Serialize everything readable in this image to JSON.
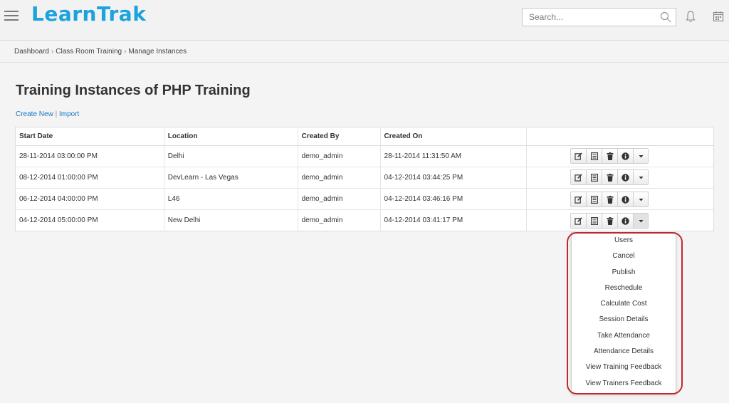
{
  "app": {
    "logo": "LearnTrak"
  },
  "search": {
    "placeholder": "Search..."
  },
  "breadcrumb": [
    "Dashboard",
    "Class Room Training",
    "Manage Instances"
  ],
  "page": {
    "title": "Training Instances of PHP Training"
  },
  "actions": {
    "create_new": "Create New",
    "separator": "|",
    "import": "Import"
  },
  "table": {
    "headers": [
      "Start Date",
      "Location",
      "Created By",
      "Created On",
      ""
    ],
    "rows": [
      {
        "start_date": "28-11-2014 03:00:00 PM",
        "location": "Delhi",
        "created_by": "demo_admin",
        "created_on": "28-11-2014 11:31:50 AM"
      },
      {
        "start_date": "08-12-2014 01:00:00 PM",
        "location": "DevLearn - Las Vegas",
        "created_by": "demo_admin",
        "created_on": "04-12-2014 03:44:25 PM"
      },
      {
        "start_date": "06-12-2014 04:00:00 PM",
        "location": "L46",
        "created_by": "demo_admin",
        "created_on": "04-12-2014 03:46:16 PM"
      },
      {
        "start_date": "04-12-2014 05:00:00 PM",
        "location": "New Delhi",
        "created_by": "demo_admin",
        "created_on": "04-12-2014 03:41:17 PM"
      }
    ],
    "row_buttons": [
      "edit-icon",
      "list-icon",
      "trash-icon",
      "info-icon",
      "caret-down-icon"
    ]
  },
  "dropdown": {
    "items": [
      "Users",
      "Cancel",
      "Publish",
      "Reschedule",
      "Calculate Cost",
      "Session Details",
      "Take Attendance",
      "Attendance Details",
      "View Training Feedback",
      "View Trainers Feedback"
    ]
  },
  "colors": {
    "brand": "#1aa3dc",
    "link": "#1a78c2",
    "highlight": "#c0282f"
  }
}
